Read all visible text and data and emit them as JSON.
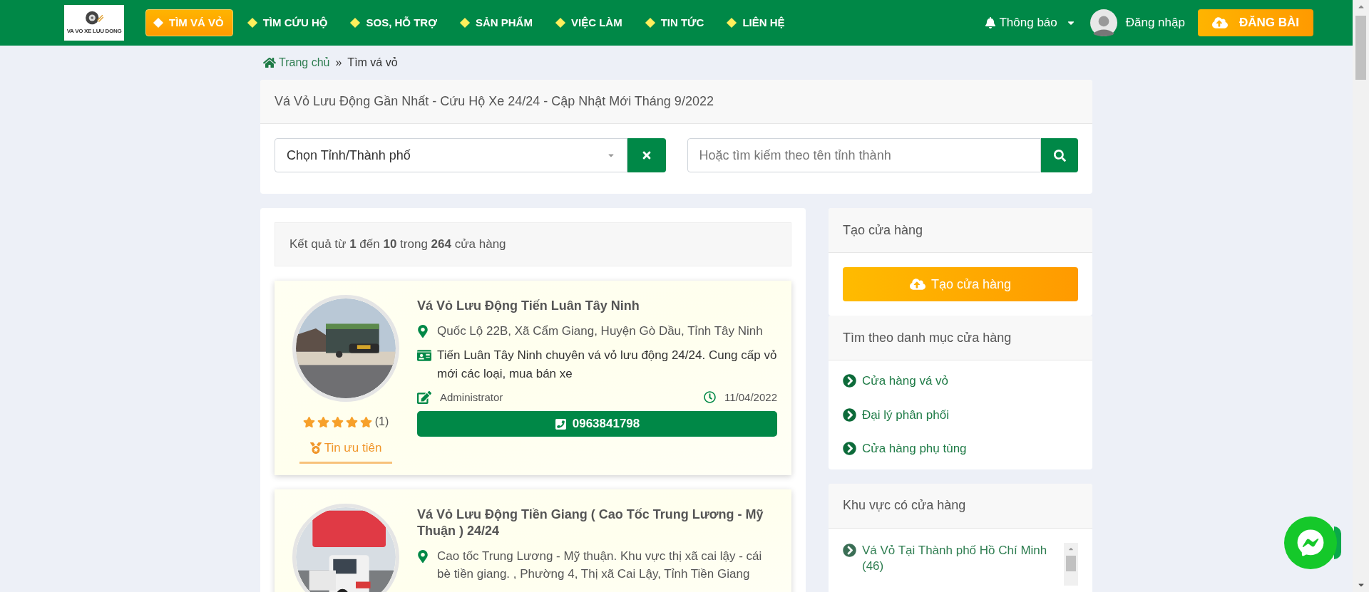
{
  "header": {
    "logo_text": "VA VO XE LUU DONG",
    "nav": [
      {
        "label": "TÌM VÁ VỎ",
        "selected": true
      },
      {
        "label": "TÌM CỨU HỘ",
        "selected": false
      },
      {
        "label": "SOS, HỖ TRỢ",
        "selected": false
      },
      {
        "label": "SẢN PHẨM",
        "selected": false
      },
      {
        "label": "VIỆC LÀM",
        "selected": false
      },
      {
        "label": "TIN TỨC",
        "selected": false
      },
      {
        "label": "LIÊN HỆ",
        "selected": false
      }
    ],
    "notifications": "Thông báo",
    "login": "Đăng nhập",
    "post_button": "ĐĂNG BÀI"
  },
  "breadcrumb": [
    {
      "label": "Trang chủ",
      "kind": "link"
    },
    {
      "label": "»",
      "kind": "separator"
    },
    {
      "label": "Tìm vá vỏ",
      "kind": "current"
    }
  ],
  "search_card": {
    "title": "Vá Vỏ Lưu Động Gần Nhất - Cứu Hộ Xe 24/24 - Cập Nhật Mới Tháng 9/2022",
    "province_select": "Chọn Tỉnh/Thành phố",
    "search_placeholder": "Hoặc tìm kiếm theo tên tỉnh thành"
  },
  "results_summary": "Kết quả từ **1** đến **10** trong **264** cửa hàng",
  "shops": [
    {
      "name": "Vá Vỏ Lưu Động Tiến Luân Tây Ninh",
      "address": "Quốc Lộ 22B, Xã Cẩm Giang, Huyện Gò Dầu, Tỉnh Tây Ninh",
      "description": "Tiến Luân Tây Ninh chuyên vá vỏ lưu động 24/24. Cung cấp vỏ mới các loại, mua bán xe",
      "author": "Administrator",
      "date": "11/04/2022",
      "phone": "0963841798",
      "stars": 5,
      "review_count": "(1)",
      "badge": "Tin ưu tiên"
    },
    {
      "name": "Vá Vỏ Lưu Động Tiền Giang ( Cao Tốc Trung Lương - Mỹ Thuận ) 24/24",
      "address": "Cao tốc Trung Lương - Mỹ thuận. Khu vực thị xã cai lậy - cái bè tiền giang. , Phường 4, Thị xã Cai Lậy, Tỉnh Tiền Giang"
    }
  ],
  "sidebar": {
    "create_title": "Tạo cửa hàng",
    "create_button": "Tạo cửa hàng",
    "category_title": "Tìm theo danh mục cửa hàng",
    "categories": [
      "Cửa hàng vá vỏ",
      "Đại lý phân phối",
      "Cửa hàng phụ tùng"
    ],
    "region_title": "Khu vực có cửa hàng",
    "regions": [
      "Vá Vỏ Tại Thành phố Hồ Chí Minh (46)"
    ]
  }
}
